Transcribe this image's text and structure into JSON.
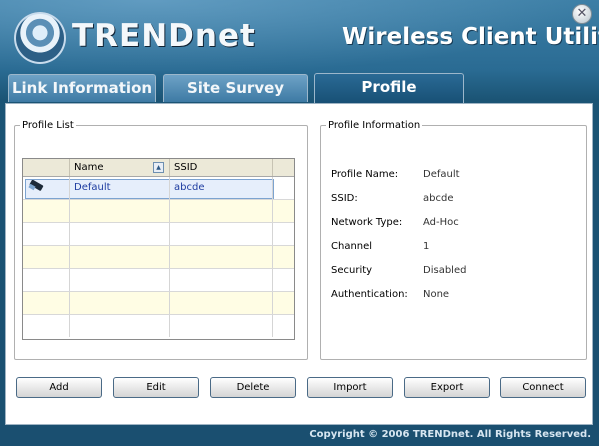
{
  "header": {
    "logo_text": "TRENDnet",
    "app_title": "Wireless Client Utility",
    "close_glyph": "✕"
  },
  "tabs": [
    {
      "label": "Link Information",
      "active": false
    },
    {
      "label": "Site Survey",
      "active": false
    },
    {
      "label": "Profile",
      "active": true
    }
  ],
  "profile_list": {
    "legend": "Profile List",
    "columns": [
      "Name",
      "SSID"
    ],
    "sort_icon": "sort-ascending-icon",
    "rows": [
      {
        "name": "Default",
        "ssid": "abcde",
        "icon": "network-card-icon",
        "selected": true
      }
    ]
  },
  "profile_info": {
    "legend": "Profile Information",
    "fields": [
      {
        "label": "Profile Name:",
        "value": "Default"
      },
      {
        "label": "SSID:",
        "value": "abcde"
      },
      {
        "label": "Network Type:",
        "value": "Ad-Hoc"
      },
      {
        "label": "Channel",
        "value": "1"
      },
      {
        "label": "Security",
        "value": "Disabled"
      },
      {
        "label": "Authentication:",
        "value": "None"
      }
    ]
  },
  "buttons": {
    "add": "Add",
    "edit": "Edit",
    "delete": "Delete",
    "import": "Import",
    "export": "Export",
    "connect": "Connect"
  },
  "footer": {
    "copyright": "Copyright © 2006 TRENDnet. All Rights Reserved."
  },
  "colors": {
    "header_bg": "#2a6b93",
    "tab_active": "#174f74",
    "row_alt": "#fffde4",
    "link_text": "#1e3ca0"
  }
}
